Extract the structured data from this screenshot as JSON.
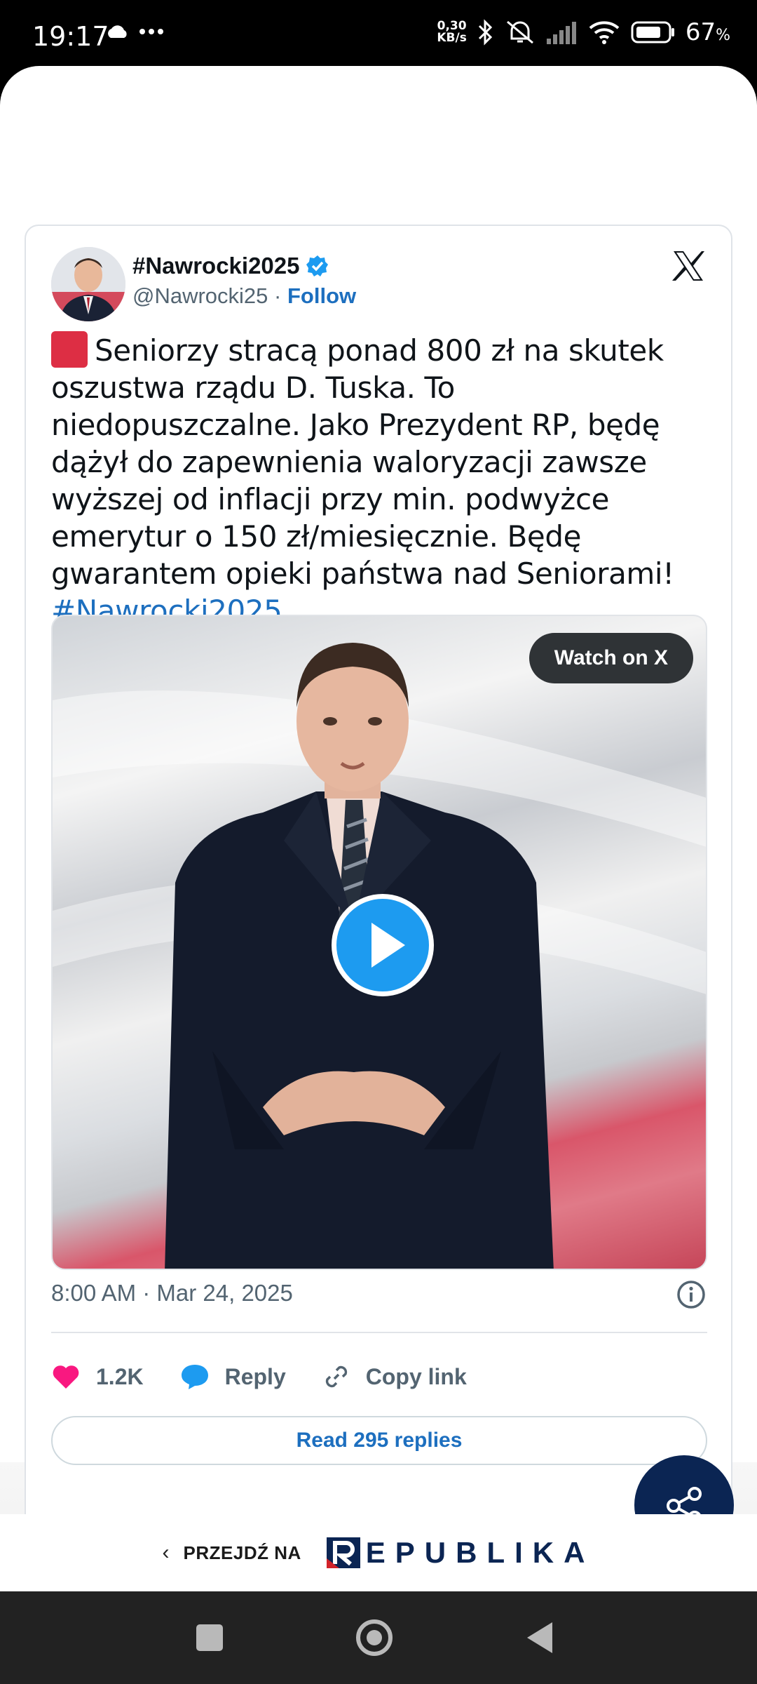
{
  "status_bar": {
    "time": "19:17",
    "speed_value": "0,30",
    "speed_unit": "KB/s",
    "battery_percent": "67",
    "battery_unit": "%",
    "icons": [
      "cloud-icon",
      "more-dots-icon",
      "bluetooth-icon",
      "silent-icon",
      "signal-icon",
      "wifi-icon",
      "battery-icon"
    ]
  },
  "tweet": {
    "display_name": "#Nawrocki2025",
    "handle": "@Nawrocki25",
    "separator": " · ",
    "follow_label": "Follow",
    "text": "Seniorzy stracą ponad 800 zł na skutek oszustwa rządu D. Tuska. To niedopuszczalne. Jako Prezydent RP, będę dążył do zapewnienia waloryzacji zawsze wyższej od inflacji przy min. podwyżce emerytur o 150 zł/miesięcznie. Będę gwarantem opieki państwa nad Seniorami! ",
    "hashtag": "#Nawrocki2025",
    "watch_label": "Watch on X",
    "timestamp": "8:00 AM · Mar 24, 2025",
    "likes": "1.2K",
    "reply_label": "Reply",
    "copy_label": "Copy link",
    "read_replies_label": "Read 295 replies"
  },
  "footer": {
    "goto_label": "PRZEJDŹ NA",
    "brand": "EPUBLIKA"
  },
  "colors": {
    "accent": "#1d6fbf",
    "like": "#f91880",
    "play": "#1d9bf0",
    "fab": "#0b2553"
  }
}
